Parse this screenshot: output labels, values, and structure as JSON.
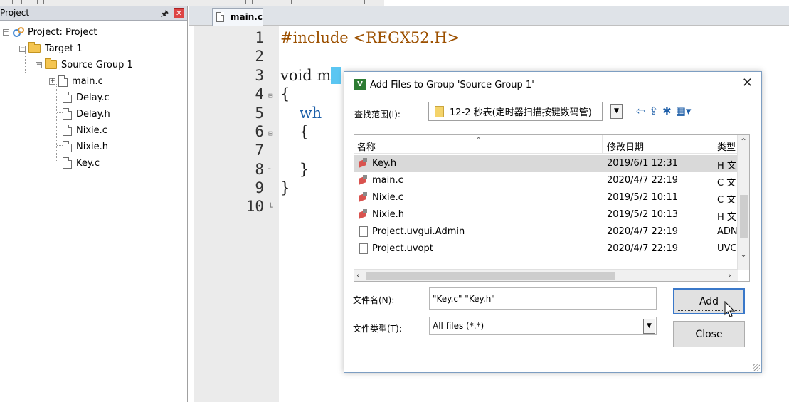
{
  "project_pane": {
    "title": "Project",
    "tree": [
      {
        "label": "Project: Project"
      },
      {
        "label": "Target 1"
      },
      {
        "label": "Source Group 1"
      },
      {
        "label": "main.c"
      },
      {
        "label": "Delay.c"
      },
      {
        "label": "Delay.h"
      },
      {
        "label": "Nixie.c"
      },
      {
        "label": "Nixie.h"
      },
      {
        "label": "Key.c"
      }
    ]
  },
  "editor": {
    "tab_label": "main.c",
    "line_numbers": [
      "1",
      "2",
      "3",
      "4",
      "5",
      "6",
      "7",
      "8",
      "9",
      "10"
    ],
    "code": {
      "l1_kw": "#include ",
      "l1_hdr": "<REGX52.H>",
      "l3_a": "void m",
      "l3_b": "  ",
      "l4": "{",
      "l5": "    wh",
      "l6": "    {",
      "l8": "    }",
      "l9": "}"
    }
  },
  "dialog": {
    "title": "Add Files to Group 'Source Group 1'",
    "look_in_label": "查找范围(I):",
    "look_in_value": "12-2 秒表(定时器扫描按键数码管)",
    "columns": [
      "名称",
      "修改日期",
      "类型"
    ],
    "files": [
      {
        "name": "Key.h",
        "date": "2019/6/1 12:31",
        "type": "H 文",
        "icon": "header-file-icon",
        "selected": true
      },
      {
        "name": "main.c",
        "date": "2020/4/7 22:19",
        "type": "C 文",
        "icon": "c-file-icon",
        "selected": false
      },
      {
        "name": "Nixie.c",
        "date": "2019/5/2 10:11",
        "type": "C 文",
        "icon": "c-file-icon",
        "selected": false
      },
      {
        "name": "Nixie.h",
        "date": "2019/5/2 10:13",
        "type": "H 文",
        "icon": "header-file-icon",
        "selected": false
      },
      {
        "name": "Project.uvgui.Admin",
        "date": "2020/4/7 22:19",
        "type": "ADN",
        "icon": "document-icon",
        "selected": false
      },
      {
        "name": "Project.uvopt",
        "date": "2020/4/7 22:19",
        "type": "UVC",
        "icon": "document-icon",
        "selected": false
      }
    ],
    "filename_label": "文件名(N):",
    "filename_value": "\"Key.c\" \"Key.h\"",
    "filetype_label": "文件类型(T):",
    "filetype_value": "All files (*.*)",
    "add_label": "Add",
    "close_label": "Close"
  }
}
